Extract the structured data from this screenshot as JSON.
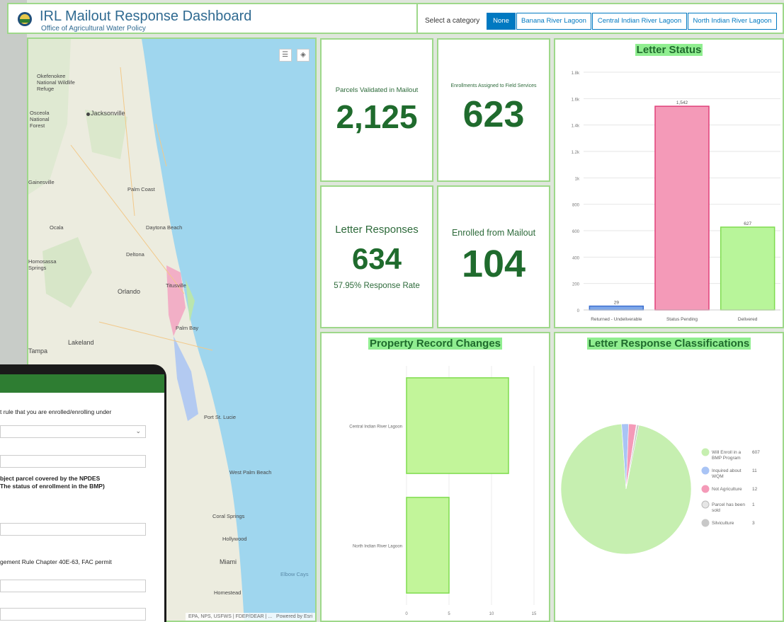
{
  "header": {
    "title": "IRL Mailout Response Dashboard",
    "subtitle": "Office of Agricultural Water Policy"
  },
  "selector": {
    "label": "Select a category",
    "options": [
      "None",
      "Banana River Lagoon",
      "Central Indian River Lagoon",
      "North Indian River Lagoon"
    ],
    "selected": "None"
  },
  "map": {
    "cities": [
      "Okefenokee National Wildlife Refuge",
      "Osceola National Forest",
      "Jacksonville",
      "Gainesville",
      "Palm Coast",
      "Ocala",
      "Daytona Beach",
      "Deltona",
      "Homosassa Springs",
      "Orlando",
      "Titusville",
      "Lakeland",
      "Tampa",
      "Palm Bay",
      "Port St. Lucie",
      "West Palm Beach",
      "Coral Springs",
      "Hollywood",
      "Miami",
      "Homestead",
      "Elbow Cays"
    ],
    "attribution": "EPA, NPS, USFWS | FDEP/DEAR | ...",
    "powered_by": "Powered by Esri"
  },
  "tablet": {
    "lines": [
      "t rule that you are enrolled/enrolling under",
      "bject parcel covered by the NPDES",
      "The status of enrollment in the BMP)",
      "gement Rule Chapter 40E-63, FAC permit"
    ]
  },
  "stats": {
    "parcels_validated": {
      "label": "Parcels Validated in Mailout",
      "value": "2,125"
    },
    "enrollments_assigned": {
      "label": "Enrollments Assigned to Field Services",
      "value": "623"
    },
    "letter_responses": {
      "label": "Letter Responses",
      "value": "634",
      "sub": "57.95% Response Rate"
    },
    "enrolled_from_mailout": {
      "label": "Enrolled from Mailout",
      "value": "104"
    }
  },
  "panels": {
    "letter_status": "Letter Status",
    "property_changes": "Property Record Changes",
    "response_classifications": "Letter Response Classifications"
  },
  "colors": {
    "green_text": "#1f6b2d",
    "selector_blue": "#0079c1",
    "bar_blue": "#7fa7e8",
    "bar_pink": "#f49ab8",
    "bar_green": "#b8f59a"
  },
  "chart_data": [
    {
      "type": "bar",
      "title": "Letter Status",
      "categories": [
        "Returned - Undeliverable",
        "Status Pending",
        "Delivered"
      ],
      "values": [
        29,
        1542,
        627
      ],
      "value_labels": [
        "29",
        "1,542",
        "627"
      ],
      "colors": [
        "#7fa7e8",
        "#f49ab8",
        "#b8f59a"
      ],
      "ylim": [
        0,
        1800
      ],
      "yticks": [
        0,
        200,
        400,
        600,
        800,
        1000,
        1200,
        1400,
        1600,
        1800
      ],
      "ytick_labels": [
        "0",
        "200",
        "400",
        "600",
        "800",
        "1k",
        "1.2k",
        "1.4k",
        "1.6k",
        "1.8k"
      ],
      "grid": true
    },
    {
      "type": "bar",
      "orientation": "horizontal",
      "title": "Property Record Changes",
      "categories": [
        "Central Indian River Lagoon",
        "North Indian River Lagoon"
      ],
      "values": [
        12,
        5
      ],
      "xlim": [
        0,
        15
      ],
      "xticks": [
        0,
        5,
        10,
        15
      ],
      "grid": true
    },
    {
      "type": "pie",
      "title": "Letter Response Classifications",
      "slices": [
        {
          "name": "Will Enroll in a BMP Program",
          "value": 607,
          "color": "#c6efb0"
        },
        {
          "name": "Inquired about WQM",
          "value": 11,
          "color": "#a9c4f5"
        },
        {
          "name": "Not Agriculture",
          "value": 12,
          "color": "#f49ab8"
        },
        {
          "name": "Parcel has been sold",
          "value": 1,
          "color": "#e6e6e6"
        },
        {
          "name": "Silviculture",
          "value": 3,
          "color": "#c8c8c8"
        }
      ],
      "legend_lines": [
        [
          "Will Enroll in a",
          "BMP Program",
          "607"
        ],
        [
          "Inquired about",
          "WQM",
          "11"
        ],
        [
          "Not Agriculture",
          "",
          "12"
        ],
        [
          "Parcel has been",
          "sold",
          "1"
        ],
        [
          "Silviculture",
          "",
          "3"
        ]
      ],
      "legend_position": "right"
    }
  ]
}
